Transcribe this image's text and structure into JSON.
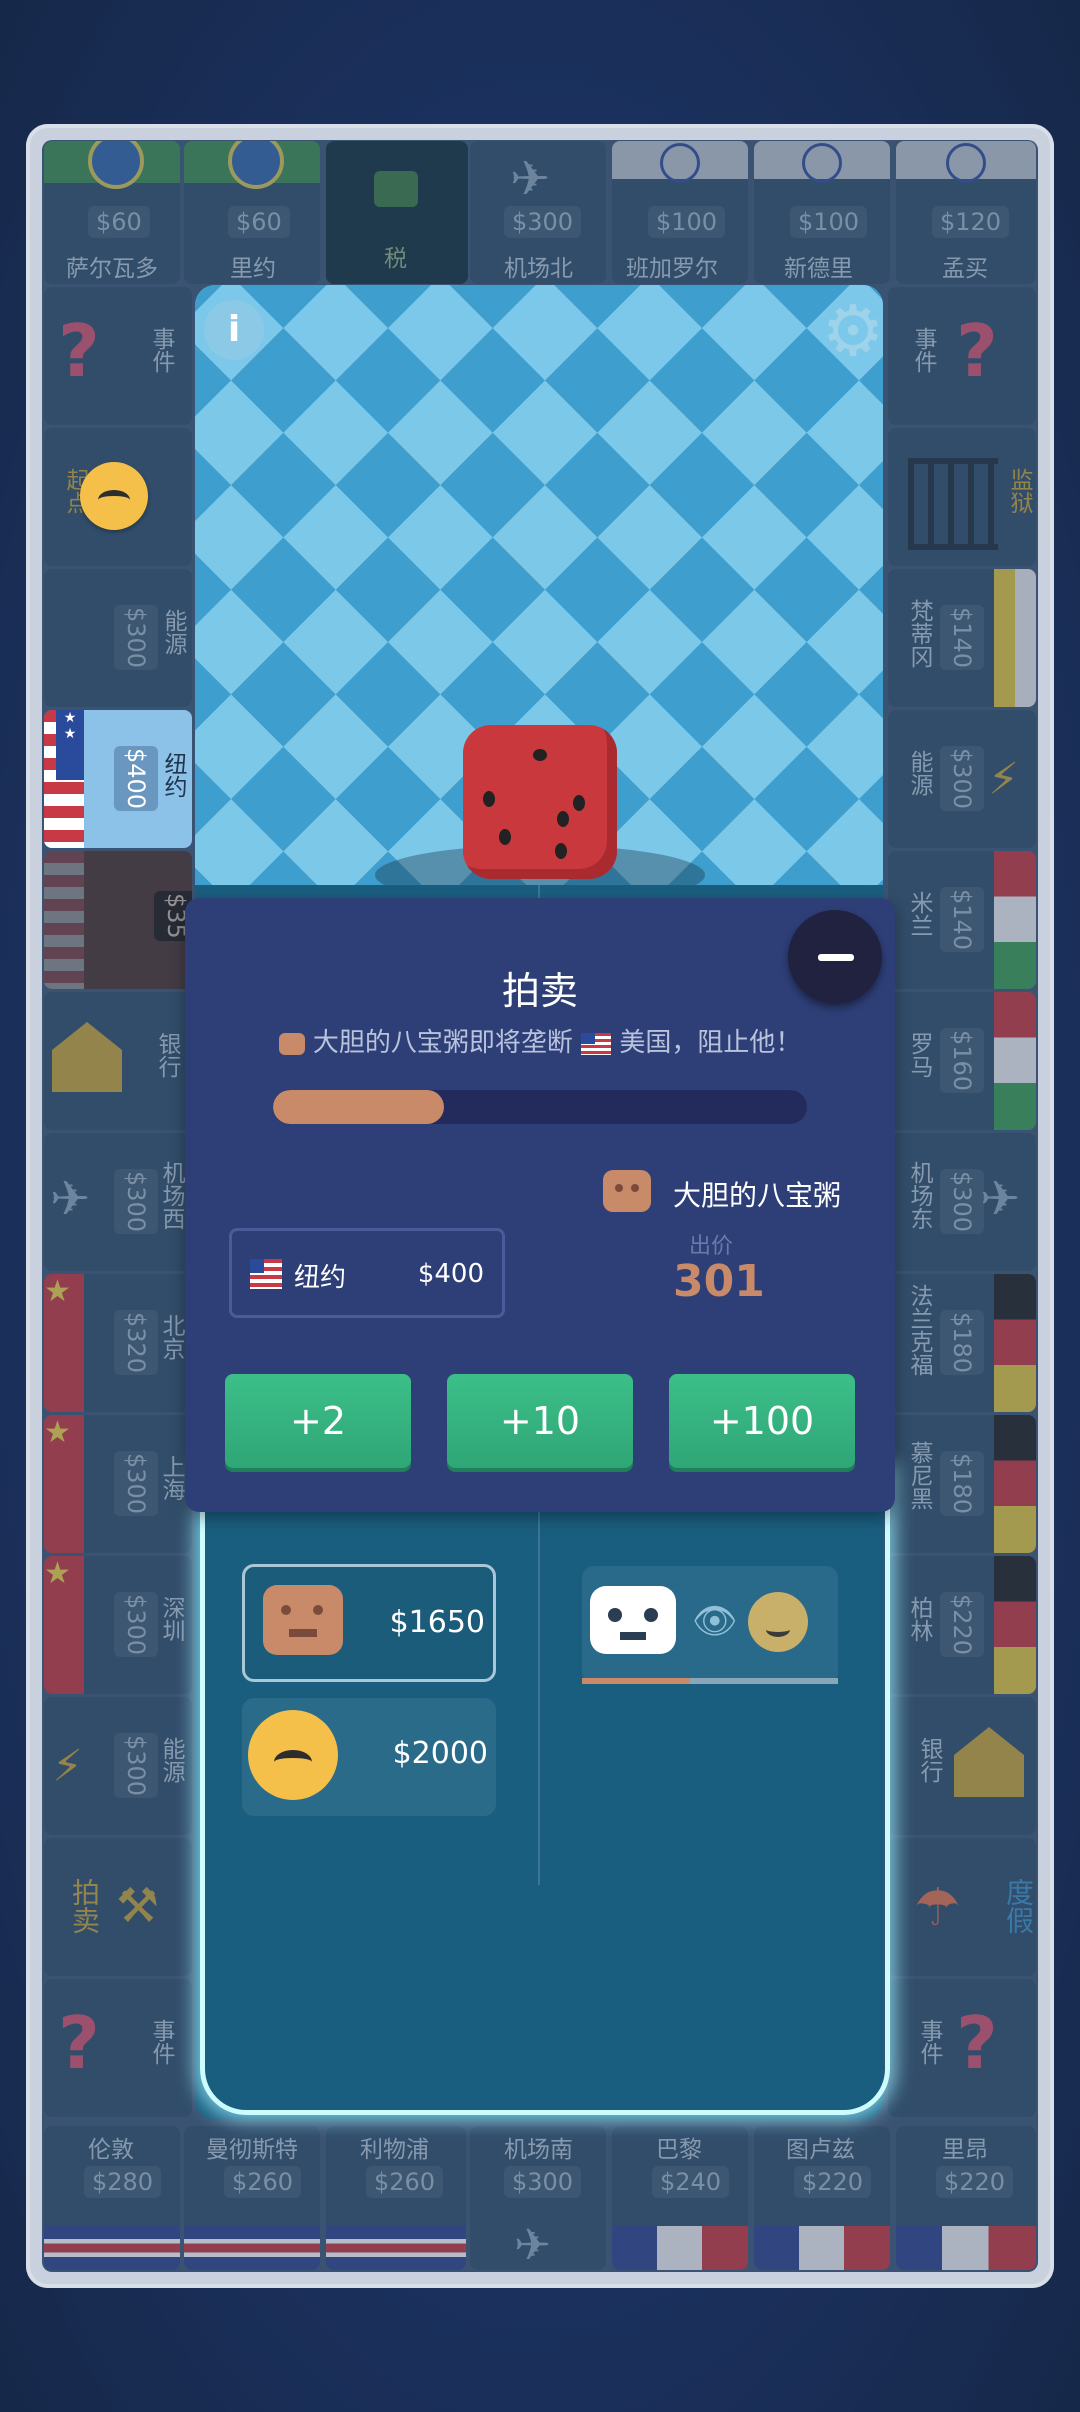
{
  "board": {
    "top": [
      {
        "price": "$60",
        "name": "萨尔瓦多"
      },
      {
        "price": "$60",
        "name": "里约"
      },
      {
        "price": "",
        "name": "税"
      },
      {
        "price": "$300",
        "name": "机场北"
      },
      {
        "price": "$100",
        "name": "班加罗尔"
      },
      {
        "price": "$100",
        "name": "新德里"
      },
      {
        "price": "$120",
        "name": "孟买"
      }
    ],
    "left": [
      {
        "price": "",
        "name": "事件"
      },
      {
        "price": "",
        "name": "起点"
      },
      {
        "price": "$300",
        "name": "能源"
      },
      {
        "price": "$400",
        "name": "纽约"
      },
      {
        "price": "$35",
        "name": ""
      },
      {
        "price": "",
        "name": "银行"
      },
      {
        "price": "$300",
        "name": "机场西"
      },
      {
        "price": "$320",
        "name": "北京"
      },
      {
        "price": "$300",
        "name": "上海"
      },
      {
        "price": "$300",
        "name": "深圳"
      },
      {
        "price": "$300",
        "name": "能源"
      },
      {
        "price": "",
        "name": "拍卖"
      },
      {
        "price": "",
        "name": "事件"
      }
    ],
    "right": [
      {
        "price": "",
        "name": "事件"
      },
      {
        "price": "",
        "name": "监狱"
      },
      {
        "price": "$140",
        "name": "梵蒂冈"
      },
      {
        "price": "$300",
        "name": "能源"
      },
      {
        "price": "$140",
        "name": "米兰"
      },
      {
        "price": "$160",
        "name": "罗马"
      },
      {
        "price": "$300",
        "name": "机场东"
      },
      {
        "price": "$180",
        "name": "法兰克福"
      },
      {
        "price": "$180",
        "name": "慕尼黑"
      },
      {
        "price": "$220",
        "name": "柏林"
      },
      {
        "price": "",
        "name": "银行"
      },
      {
        "price": "",
        "name": "度假"
      },
      {
        "price": "",
        "name": "事件"
      }
    ],
    "bottom": [
      {
        "price": "$280",
        "name": "伦敦"
      },
      {
        "price": "$260",
        "name": "曼彻斯特"
      },
      {
        "price": "$260",
        "name": "利物浦"
      },
      {
        "price": "$300",
        "name": "机场南"
      },
      {
        "price": "$240",
        "name": "巴黎"
      },
      {
        "price": "$220",
        "name": "图卢兹"
      },
      {
        "price": "$220",
        "name": "里昂"
      }
    ]
  },
  "auction": {
    "title": "拍卖",
    "message_pre": "大胆的八宝粥即将垄断",
    "message_post": "美国，阻止他！",
    "timer_remaining": 0.32,
    "property_name": "纽约",
    "property_price": "$400",
    "bidder_name": "大胆的八宝粥",
    "bid_label": "出价",
    "bid_value": "301",
    "buttons": [
      "+2",
      "+10",
      "+100"
    ]
  },
  "players": [
    {
      "money": "$1650"
    },
    {
      "money": "$2000"
    }
  ],
  "colors": {
    "accent": "#3cbf89",
    "panel": "#2e3f78",
    "bid": "#c98a6a"
  }
}
